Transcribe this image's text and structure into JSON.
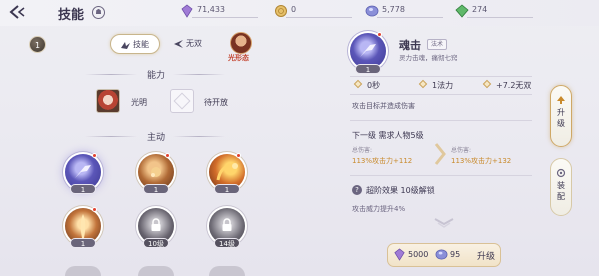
{
  "header": {
    "title": "技能",
    "resources": [
      {
        "icon": "purple-crystal-icon",
        "value": "71,433"
      },
      {
        "icon": "gold-coin-icon",
        "value": "0"
      },
      {
        "icon": "blue-gem-icon",
        "value": "5,778"
      },
      {
        "icon": "green-gem-icon",
        "value": "274"
      }
    ]
  },
  "left": {
    "level_badge": "1",
    "tabs": [
      {
        "label": "技能",
        "icon": "skill-wing-icon",
        "selected": true
      },
      {
        "label": "无双",
        "icon": "wushuang-icon",
        "selected": false
      }
    ],
    "form_label": "光形态",
    "abilities_title": "能力",
    "abilities": [
      {
        "label": "光明",
        "icon": "light-portrait-icon"
      },
      {
        "label": "待开放",
        "icon": "locked-slot-icon"
      }
    ],
    "active_title": "主动",
    "skills": [
      {
        "level": "1",
        "icon": "soul-strike-icon",
        "selected": true,
        "badge": true
      },
      {
        "level": "1",
        "icon": "fire-orb-icon",
        "selected": false,
        "badge": true
      },
      {
        "level": "1",
        "icon": "flame-arc-icon",
        "selected": false,
        "badge": true
      },
      {
        "level": "1",
        "icon": "flame-pillar-icon",
        "selected": false,
        "badge": true
      },
      {
        "level": "10级",
        "icon": "lock-icon",
        "selected": false,
        "badge": false
      },
      {
        "level": "14级",
        "icon": "lock-icon",
        "selected": false,
        "badge": false
      }
    ]
  },
  "detail": {
    "name": "魂击",
    "type_tag": "法术",
    "subtitle": "灵力击魂，痛彻七窍",
    "level": "1",
    "stats": {
      "cooldown": "0秒",
      "mana": "1法力",
      "wushuang": "+7.2无双"
    },
    "description": "攻击目标并造成伤害",
    "next_level": "下一级 需求人物5级",
    "current": {
      "label": "总伤害:",
      "value": "113%攻击力+112"
    },
    "next": {
      "label": "总伤害:",
      "value": "113%攻击力+132"
    },
    "advanced": {
      "title": "超阶效果 10级解锁",
      "description": "攻击威力提升4%"
    },
    "cost": [
      {
        "icon": "purple-crystal-icon",
        "value": "5000"
      },
      {
        "icon": "blue-gem-icon",
        "value": "95"
      }
    ],
    "upgrade_label": "升级"
  },
  "side_tabs": [
    {
      "label": "升级",
      "icon": "upgrade-icon",
      "selected": true
    },
    {
      "label": "装配",
      "icon": "equip-icon",
      "selected": false
    }
  ]
}
